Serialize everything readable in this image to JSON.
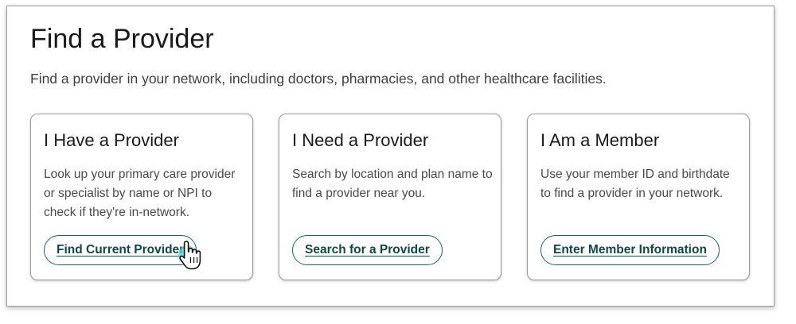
{
  "page": {
    "title": "Find a Provider",
    "subtitle": "Find a provider in your network, including doctors, pharmacies, and other healthcare facilities."
  },
  "cards": [
    {
      "title": "I Have a Provider",
      "description": "Look up your primary care provider or specialist by name or NPI to check if they're in-network.",
      "button_label": "Find Current Provider"
    },
    {
      "title": "I Need a Provider",
      "description": "Search by location and plan name to find a provider near you.",
      "button_label": "Search for a Provider"
    },
    {
      "title": "I Am a Member",
      "description": "Use your member ID and birthdate to find a provider in your network.",
      "button_label": "Enter Member Information"
    }
  ],
  "colors": {
    "accent": "#0e6b63",
    "button_text": "#0c4a45",
    "cursor_highlight": "#4fd1d1"
  },
  "cursor": {
    "icon": "hand-pointer-icon",
    "hovering": "find-current-provider-button"
  }
}
